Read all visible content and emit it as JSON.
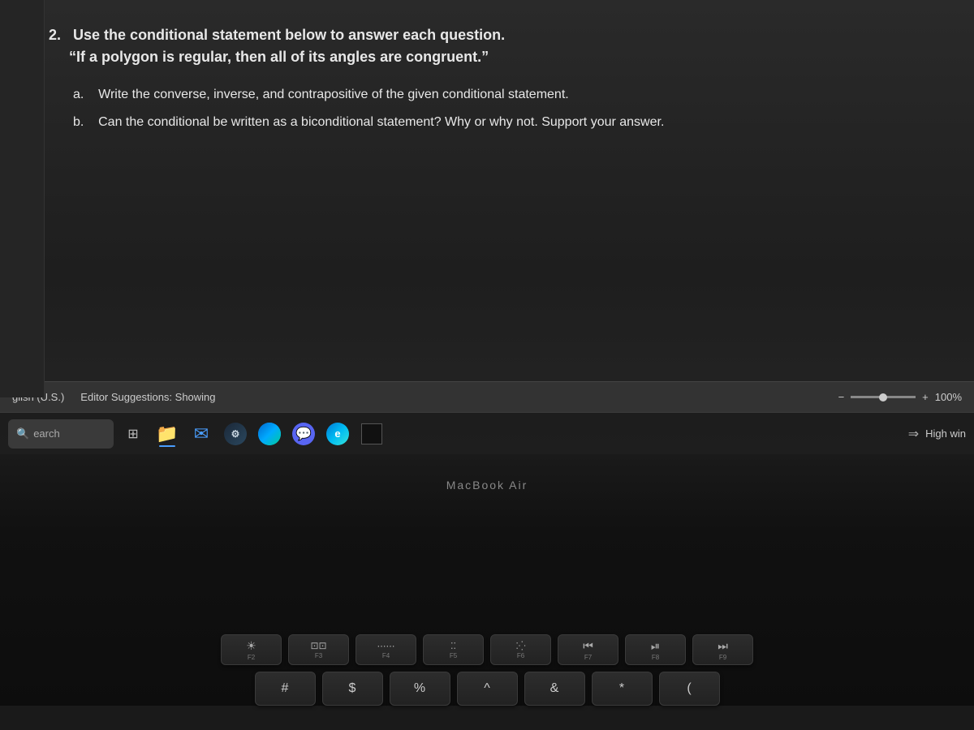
{
  "screen": {
    "question_number": "2.",
    "question_intro": "Use the conditional statement below to answer each question.",
    "question_quote": "“If a polygon is regular, then all of its angles are congruent.”",
    "part_a_label": "a.",
    "part_a_text": "Write the converse, inverse, and contrapositive of the given conditional statement.",
    "part_b_label": "b.",
    "part_b_text": "Can the conditional be written as a biconditional statement? Why or why not. Support your answer."
  },
  "status_bar": {
    "language": "glish (U.S.)",
    "editor_suggestions": "Editor Suggestions: Showing",
    "minus_label": "−",
    "plus_label": "+",
    "zoom": "100%"
  },
  "taskbar": {
    "search_placeholder": "earch",
    "taskview_label": "≡",
    "high_win_text": "High win",
    "arrow_label": "⇒"
  },
  "macbook": {
    "label": "MacBook Air"
  },
  "keyboard": {
    "fn_keys": [
      {
        "symbol": "☀",
        "label": "F2"
      },
      {
        "symbol": "⚊",
        "label": "F3"
      },
      {
        "symbol": "……",
        "label": "F4"
      },
      {
        "symbol": "‥‥",
        "label": "F5"
      },
      {
        "symbol": "‥…",
        "label": "F6"
      },
      {
        "symbol": "◄◄",
        "label": "F7"
      },
      {
        "symbol": "►►",
        "label": "F8"
      },
      {
        "symbol": "►►►",
        "label": "F9"
      }
    ],
    "char_keys": [
      {
        "symbol": "#",
        "sub": ""
      },
      {
        "symbol": "$",
        "sub": ""
      },
      {
        "symbol": "%",
        "sub": ""
      },
      {
        "symbol": "^",
        "sub": ""
      },
      {
        "symbol": "&",
        "sub": ""
      },
      {
        "symbol": "*",
        "sub": ""
      },
      {
        "symbol": "(",
        "sub": ""
      }
    ]
  },
  "icons": {
    "search": "🔍",
    "taskview": "☰",
    "folder": "📁",
    "mail": "✉",
    "steam": "S",
    "cortana": "C",
    "discord": "💬",
    "edge": "e"
  },
  "colors": {
    "background": "#1e1e1e",
    "taskbar": "#1e1e1e",
    "text_primary": "#e8e8e8",
    "text_muted": "#999",
    "accent": "#4a9eff",
    "folder_color": "#F4B942",
    "discord_color": "#5865F2"
  }
}
